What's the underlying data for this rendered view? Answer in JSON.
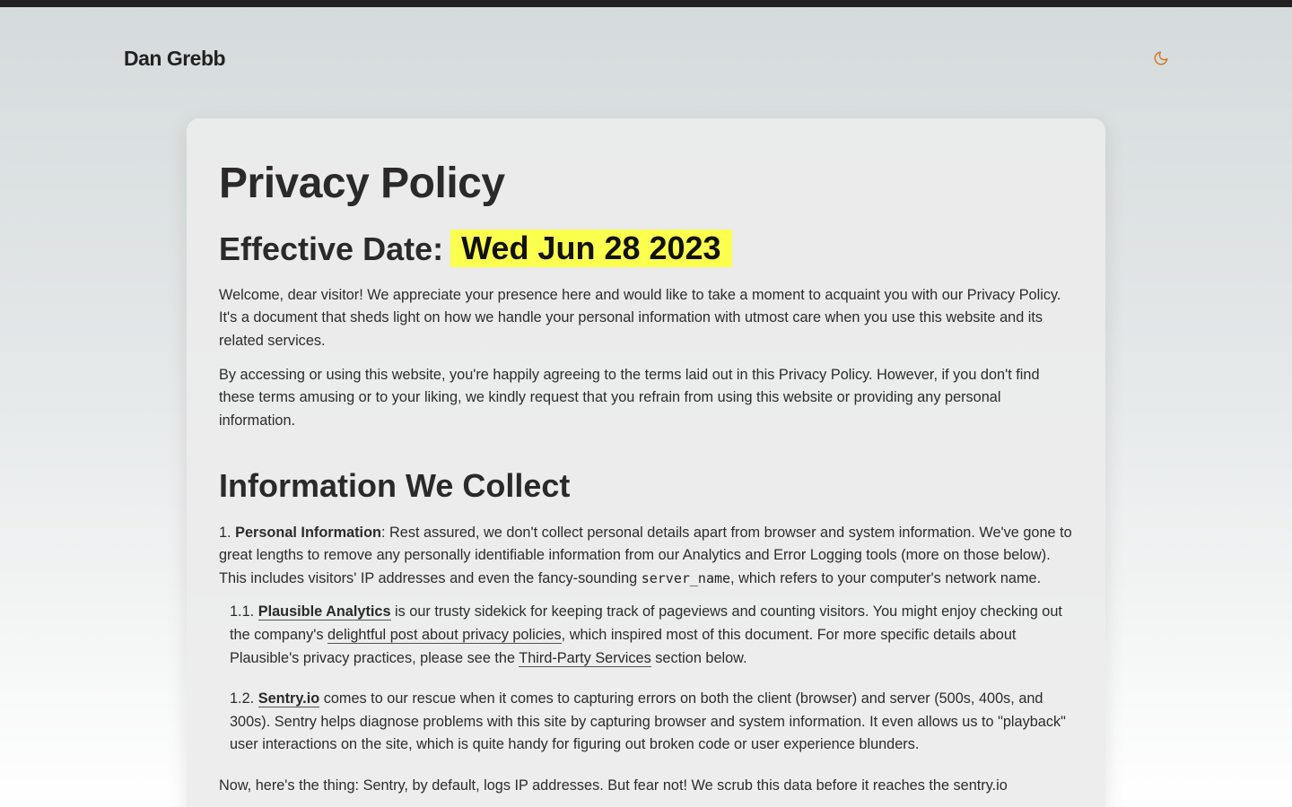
{
  "header": {
    "brand": "Dan Grebb",
    "theme_toggle_icon": "moon-icon",
    "theme_toggle_color": "#d07a2a"
  },
  "colors": {
    "topbar": "#222222",
    "highlight": "#fbff4e"
  },
  "article": {
    "title": "Privacy Policy",
    "effective_label": "Effective Date:",
    "effective_date": "Wed Jun 28 2023",
    "intro": "Welcome, dear visitor! We appreciate your presence here and would like to take a moment to acquaint you with our Privacy Policy. It's a document that sheds light on how we handle your personal information with utmost care when you use this website and its related services.",
    "agree": "By accessing or using this website, you're happily agreeing to the terms laid out in this Privacy Policy. However, if you don't find these terms amusing or to your liking, we kindly request that you refrain from using this website or providing any personal information.",
    "section_collect": "Information We Collect",
    "personal": {
      "number": "1.",
      "label": "Personal Information",
      "text_a": ": Rest assured, we don't collect personal details apart from browser and system information. We've gone to great lengths to remove any personally identifiable information from our Analytics and Error Logging tools (more on those below). This includes visitors' IP addresses and even the fancy-sounding ",
      "code": "server_name",
      "text_b": ", which refers to your computer's network name."
    },
    "plausible": {
      "number": "1.1.",
      "link": "Plausible Analytics",
      "text_a": " is our trusty sidekick for keeping track of pageviews and counting visitors. You might enjoy checking out the company's ",
      "post_link": "delightful post about privacy policies",
      "text_b": ", which inspired most of this document. For more specific details about Plausible's privacy practices, please see the ",
      "third_party_link": "Third-Party Services",
      "text_c": " section below."
    },
    "sentry": {
      "number": "1.2.",
      "link": "Sentry.io",
      "text": " comes to our rescue when it comes to capturing errors on both the client (browser) and server (500s, 400s, and 300s). Sentry helps diagnose problems with this site by capturing browser and system information. It even allows us to \"playback\" user interactions on the site, which is quite handy for figuring out broken code or user experience blunders."
    },
    "now": "Now, here's the thing: Sentry, by default, logs IP addresses. But fear not! We scrub this data before it reaches the sentry.io"
  }
}
